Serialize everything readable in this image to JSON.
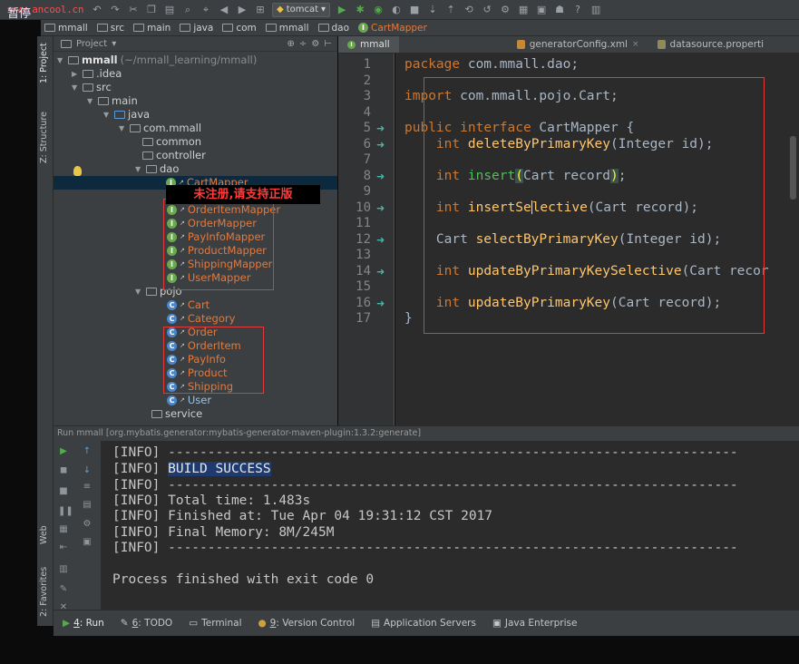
{
  "watermark": {
    "text": "暂停",
    "url": "www.ancool.cn"
  },
  "toolbar": {
    "run_config": "tomcat"
  },
  "breadcrumb": [
    "mmall",
    "src",
    "main",
    "java",
    "com",
    "mmall",
    "dao",
    "CartMapper"
  ],
  "project_panel": {
    "title": "Project",
    "root": "mmall",
    "root_path": "(~/mmall_learning/mmall)",
    "folders": {
      "idea": ".idea",
      "src": "src",
      "main": "main",
      "java": "java",
      "pkg": "com.mmall",
      "common": "common",
      "controller": "controller",
      "dao": "dao",
      "pojo": "pojo",
      "service": "service"
    },
    "dao_items": [
      "CartMapper",
      "OrderItemMapper",
      "OrderMapper",
      "PayInfoMapper",
      "ProductMapper",
      "ShippingMapper",
      "UserMapper"
    ],
    "pojo_items": [
      "Cart",
      "Category",
      "Order",
      "OrderItem",
      "PayInfo",
      "Product",
      "Shipping",
      "User"
    ]
  },
  "overlay_banner": "未注册,请支持正版",
  "left_tool_windows": {
    "project": "1: Project",
    "structure": "Z: Structure",
    "web": "Web",
    "favorites": "2: Favorites"
  },
  "editor": {
    "tabs": [
      "mmall",
      "generatorConfig.xml",
      "datasource.properti"
    ],
    "line_numbers": [
      "1",
      "2",
      "3",
      "4",
      "5",
      "6",
      "7",
      "8",
      "9",
      "10",
      "11",
      "12",
      "13",
      "14",
      "15",
      "16",
      "17"
    ],
    "code": {
      "package_kw": "package",
      "package_name": " com.mmall.dao;",
      "import_kw": "import",
      "import_name": " com.mmall.pojo.Cart;",
      "public_kw": "public",
      "interface_kw": "interface",
      "class_name": " CartMapper {",
      "int_kw": "int",
      "m1_name": "deleteByPrimaryKey",
      "m1_args": "(Integer id);",
      "m2_name": "insert",
      "m2_args": "Cart record",
      "m2_end": ";",
      "m3_name1": "insertSe",
      "m3_name2": "lective",
      "m3_args": "(Cart record);",
      "m4_type": "Cart ",
      "m4_name": "selectByPrimaryKey",
      "m4_args": "(Integer id);",
      "m5_name": "updateByPrimaryKeySelective",
      "m5_args": "(Cart recor",
      "m6_name": "updateByPrimaryKey",
      "m6_args": "(Cart record);",
      "close": "}"
    }
  },
  "run_panel": {
    "header": "Run    mmall [org.mybatis.generator:mybatis-generator-maven-plugin:1.3.2:generate]",
    "lines": {
      "l1": "[INFO] ------------------------------------------------------------------------",
      "l2_prefix": "[INFO] ",
      "l2_build": "BUILD SUCCESS",
      "l3": "[INFO] ------------------------------------------------------------------------",
      "l4": "[INFO] Total time: 1.483s",
      "l5": "[INFO] Finished at: Tue Apr 04 19:31:12 CST 2017",
      "l6": "[INFO] Final Memory: 8M/245M",
      "l7": "[INFO] ------------------------------------------------------------------------",
      "l8": "Process finished with exit code 0"
    }
  },
  "statusbar": {
    "run_num": "4",
    "run_label": ": Run",
    "todo_num": "6",
    "todo_label": ": TODO",
    "terminal": "Terminal",
    "vc_num": "9",
    "vc_label": ": Version Control",
    "app_servers": "Application Servers",
    "java_ee": "Java Enterprise"
  }
}
